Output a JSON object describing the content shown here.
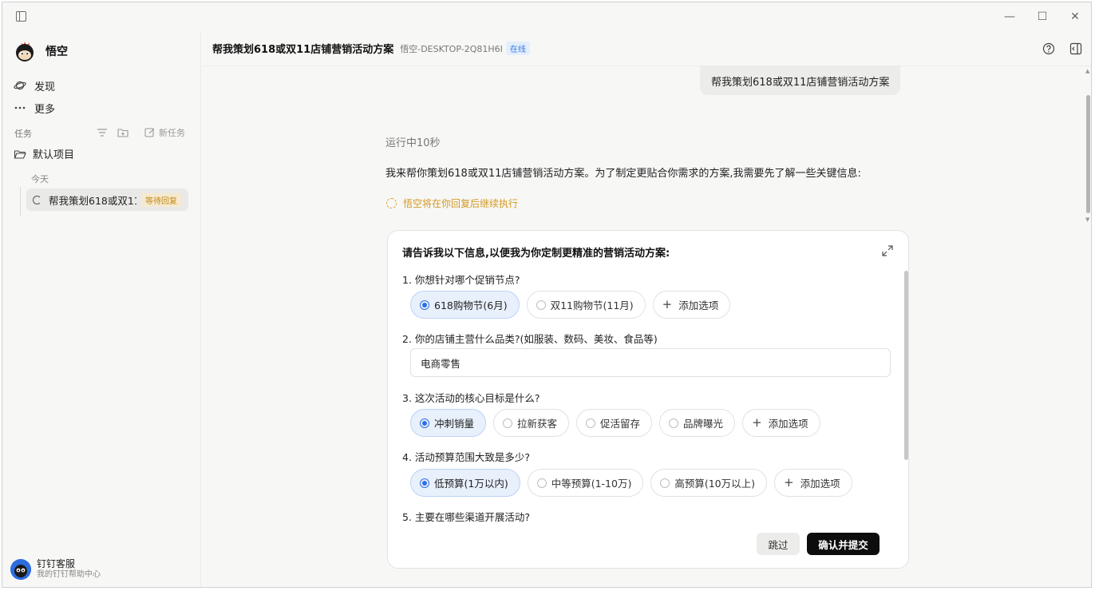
{
  "window": {
    "controls": {
      "minimize": "—",
      "maximize": "☐",
      "close": "✕"
    }
  },
  "sidebar": {
    "brand": "悟空",
    "nav": [
      {
        "label": "发现",
        "icon": "planet-icon"
      },
      {
        "label": "更多",
        "icon": "more-dots-icon"
      }
    ],
    "section_label": "任务",
    "new_task_label": "新任务",
    "project_name": "默认项目",
    "group_label": "今天",
    "task": {
      "title": "帮我策划618或双11店铺营销活动方案",
      "badge": "等待回复"
    },
    "support": {
      "name": "钉钉客服",
      "subtitle": "我的钉钉帮助中心"
    }
  },
  "header": {
    "title": "帮我策划618或双11店铺营销活动方案",
    "device": "悟空-DESKTOP-2Q81H6I",
    "status": "在线"
  },
  "conversation": {
    "user_message": "帮我策划618或双11店铺营销活动方案",
    "running": "运行中10秒",
    "reply": "我来帮你策划618或双11店铺营销活动方案。为了制定更贴合你需求的方案,我需要先了解一些关键信息:",
    "waiting": "悟空将在你回复后继续执行"
  },
  "form": {
    "title": "请告诉我以下信息,以便我为你定制更精准的营销活动方案:",
    "add_option_label": "添加选项",
    "questions": [
      {
        "label": "1. 你想针对哪个促销节点?",
        "options": [
          "618购物节(6月)",
          "双11购物节(11月)"
        ],
        "selected": 0
      },
      {
        "label": "2. 你的店铺主营什么品类?(如服装、数码、美妆、食品等)",
        "value": "电商零售"
      },
      {
        "label": "3. 这次活动的核心目标是什么?",
        "options": [
          "冲刺销量",
          "拉新获客",
          "促活留存",
          "品牌曝光"
        ],
        "selected": 0
      },
      {
        "label": "4. 活动预算范围大致是多少?",
        "options": [
          "低预算(1万以内)",
          "中等预算(1-10万)",
          "高预算(10万以上)"
        ],
        "selected": 0
      },
      {
        "label": "5. 主要在哪些渠道开展活动?"
      }
    ],
    "skip_label": "跳过",
    "submit_label": "确认并提交"
  },
  "colors": {
    "accent": "#2f6fe4",
    "selected_bg": "#e8f0fc",
    "waiting": "#d29a1e",
    "submit_bg": "#0d0d0d"
  }
}
